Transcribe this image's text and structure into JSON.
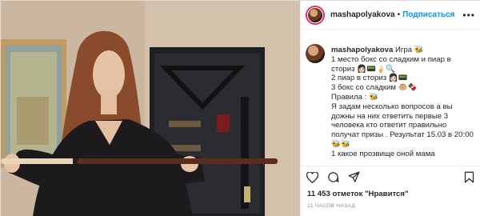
{
  "post": {
    "username": "mashapolyakova",
    "separator": "•",
    "follow_label": "Подписаться",
    "more_label": "•••",
    "caption": {
      "username": "mashapolyakova",
      "lines": [
        "Игра 🐝",
        "1 место бокс со сладким и пиар в сториз 👩🏻📟🍦🔍",
        "2 пиар в сториз 👩🏻📟",
        "3 бокс со сладким 🐵🍫",
        "Правила : 🐝",
        "Я задам несколько вопросов а вы дожны на них ответить первые 3 человека кто ответит правильно получат призы . Результат 15.03 в 20:00 🐝🐝",
        "1 какое прозвище оной мама"
      ]
    },
    "likes_text": "11 453 отметок \"Нравится\"",
    "time_text": "11 ЧАСОВ НАЗАД"
  },
  "icons": {
    "like": "heart-icon",
    "comment": "comment-icon",
    "share": "share-icon",
    "save": "bookmark-icon"
  }
}
